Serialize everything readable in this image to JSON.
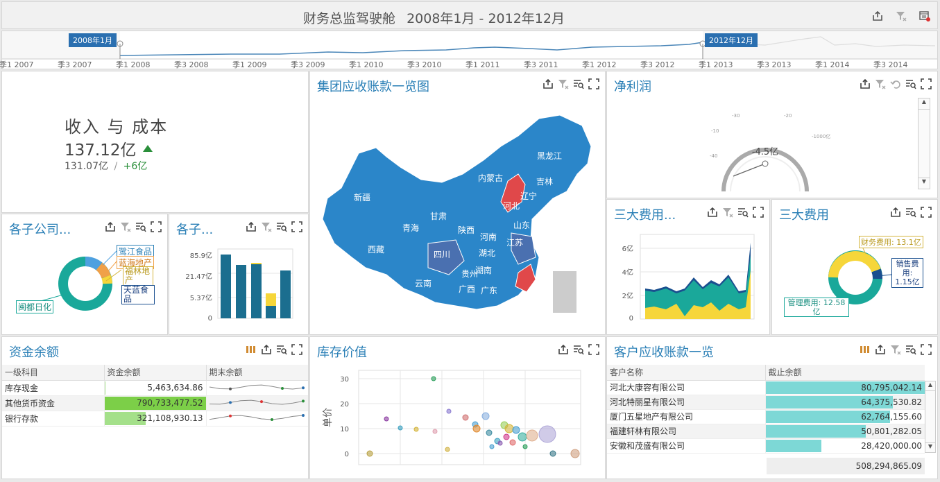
{
  "header": {
    "title": "财务总监驾驶舱",
    "date_range": "2008年1月 - 2012年12月"
  },
  "timeline": {
    "start_marker": "2008年1月",
    "end_marker": "2012年12月",
    "ticks": [
      "季1 2007",
      "季3 2007",
      "季1 2008",
      "季3 2008",
      "季1 2009",
      "季3 2009",
      "季1 2010",
      "季3 2010",
      "季1 2011",
      "季3 2011",
      "季1 2012",
      "季3 2012",
      "季1 2013",
      "季3 2013",
      "季1 2014",
      "季3 2014"
    ]
  },
  "kpi": {
    "title": "收入 与 成本",
    "value": "137.12亿",
    "sub_value": "131.07亿",
    "separator": "/",
    "delta": "+6亿"
  },
  "map_panel": {
    "title": "集团应收账款一览图",
    "regions": [
      "黑龙江",
      "吉林",
      "内蒙古",
      "辽宁",
      "新疆",
      "河北",
      "甘肃",
      "山东",
      "青海",
      "陕西",
      "河南",
      "江苏",
      "西藏",
      "四川",
      "湖北",
      "贵州",
      "湖南",
      "云南",
      "广西",
      "广东"
    ]
  },
  "profit": {
    "title": "净利润",
    "value": "-4.5亿",
    "scale_labels": [
      "-40",
      "-30",
      "-20",
      "-10",
      "-1000亿"
    ]
  },
  "donut_companies": {
    "title": "各子公司...",
    "labels": [
      "鹭江食品",
      "蓝海地产",
      "福林地产",
      "天蓝食品",
      "闽都日化"
    ]
  },
  "bar_companies": {
    "title": "各子...",
    "y_ticks": [
      "85.9亿",
      "21.47亿",
      "5.37亿",
      "0"
    ]
  },
  "expenses_area": {
    "title": "三大费用...",
    "y_ticks": [
      "6亿",
      "4亿",
      "2亿",
      "0"
    ]
  },
  "expenses_donut": {
    "title": "三大费用",
    "labels": {
      "finance": "财务费用: 13.1亿",
      "sales": "销售费用: 1.15亿",
      "admin": "管理费用: 12.58亿"
    }
  },
  "funds": {
    "title": "资金余额",
    "columns": [
      "一级科目",
      "资金余额",
      "期末余额"
    ],
    "rows": [
      {
        "name": "库存现金",
        "amount": "5,463,634.86",
        "bar": 0.01
      },
      {
        "name": "其他货币资金",
        "amount": "790,733,477.52",
        "bar": 1.0
      },
      {
        "name": "银行存款",
        "amount": "321,108,930.13",
        "bar": 0.41
      }
    ]
  },
  "inventory": {
    "title": "库存价值",
    "ylabel": "单价",
    "y_ticks": [
      "30",
      "20",
      "10",
      "0"
    ]
  },
  "receivables": {
    "title": "客户应收账款一览",
    "columns": [
      "客户名称",
      "截止余额"
    ],
    "rows": [
      {
        "name": "河北大康容有限公司",
        "amount": "80,795,042.14",
        "bar": 1.0
      },
      {
        "name": "河北特丽星有限公司",
        "amount": "64,375,530.82",
        "bar": 0.8
      },
      {
        "name": "厦门五星地产有限公司",
        "amount": "62,764,155.60",
        "bar": 0.78
      },
      {
        "name": "福建轩林有限公司",
        "amount": "50,801,282.05",
        "bar": 0.63
      },
      {
        "name": "安徽和茂盛有限公司",
        "amount": "28,420,000.00",
        "bar": 0.35
      }
    ],
    "total": "508,294,865.09"
  },
  "colors": {
    "accent": "#2a7fb6",
    "map_blue": "#2b86c9",
    "map_red": "#e0484a",
    "teal": "#1aa89a",
    "yellow": "#f6d63a",
    "navy": "#1a4f8f",
    "green_bar": "#7ccf48",
    "teal_bar": "#7dd8d6"
  }
}
